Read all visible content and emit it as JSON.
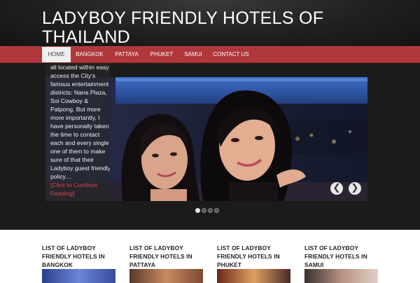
{
  "site": {
    "title": "LADYBOY FRIENDLY HOTELS OF THAILAND"
  },
  "nav": {
    "items": [
      {
        "label": "HOME"
      },
      {
        "label": "BANGKOK"
      },
      {
        "label": "PATTAYA"
      },
      {
        "label": "PHUKET"
      },
      {
        "label": "SAMUI"
      },
      {
        "label": "CONTACT US"
      }
    ],
    "active": "HOME"
  },
  "slider": {
    "caption": {
      "text": "all located within easy access the  City's famous entertainment districts: Nana Plaza, Soi Cowboy & Patpong. But more more importantly, I have  personally taken the time to contact each and every single one of them to make sure of that their Ladyboy guest friendly policy…",
      "link": "[Click to Continue Reading]"
    },
    "prev_arrow": "❮",
    "next_arrow": "❯",
    "slide_count": 4,
    "active_slide": 1
  },
  "sections": [
    {
      "title": "LIST OF LADYBOY FRIENDLY HOTELS IN BANGKOK"
    },
    {
      "title": "LIST OF LADYBOY FRIENDLY HOTELS IN PATTAYA"
    },
    {
      "title": "LIST OF LADYBOY FRIENDLY HOTELS IN PHUKET"
    },
    {
      "title": "LIST OF LADYBOY FRIENDLY HOTELS IN SAMUI"
    }
  ],
  "colors": {
    "header_bg": "#202020",
    "nav_bg": "#b0373c",
    "slider_bg": "#1b1b1b",
    "link_accent": "#d6454a"
  },
  "icons": {
    "prev": "chevron-left-icon",
    "next": "chevron-right-icon"
  }
}
